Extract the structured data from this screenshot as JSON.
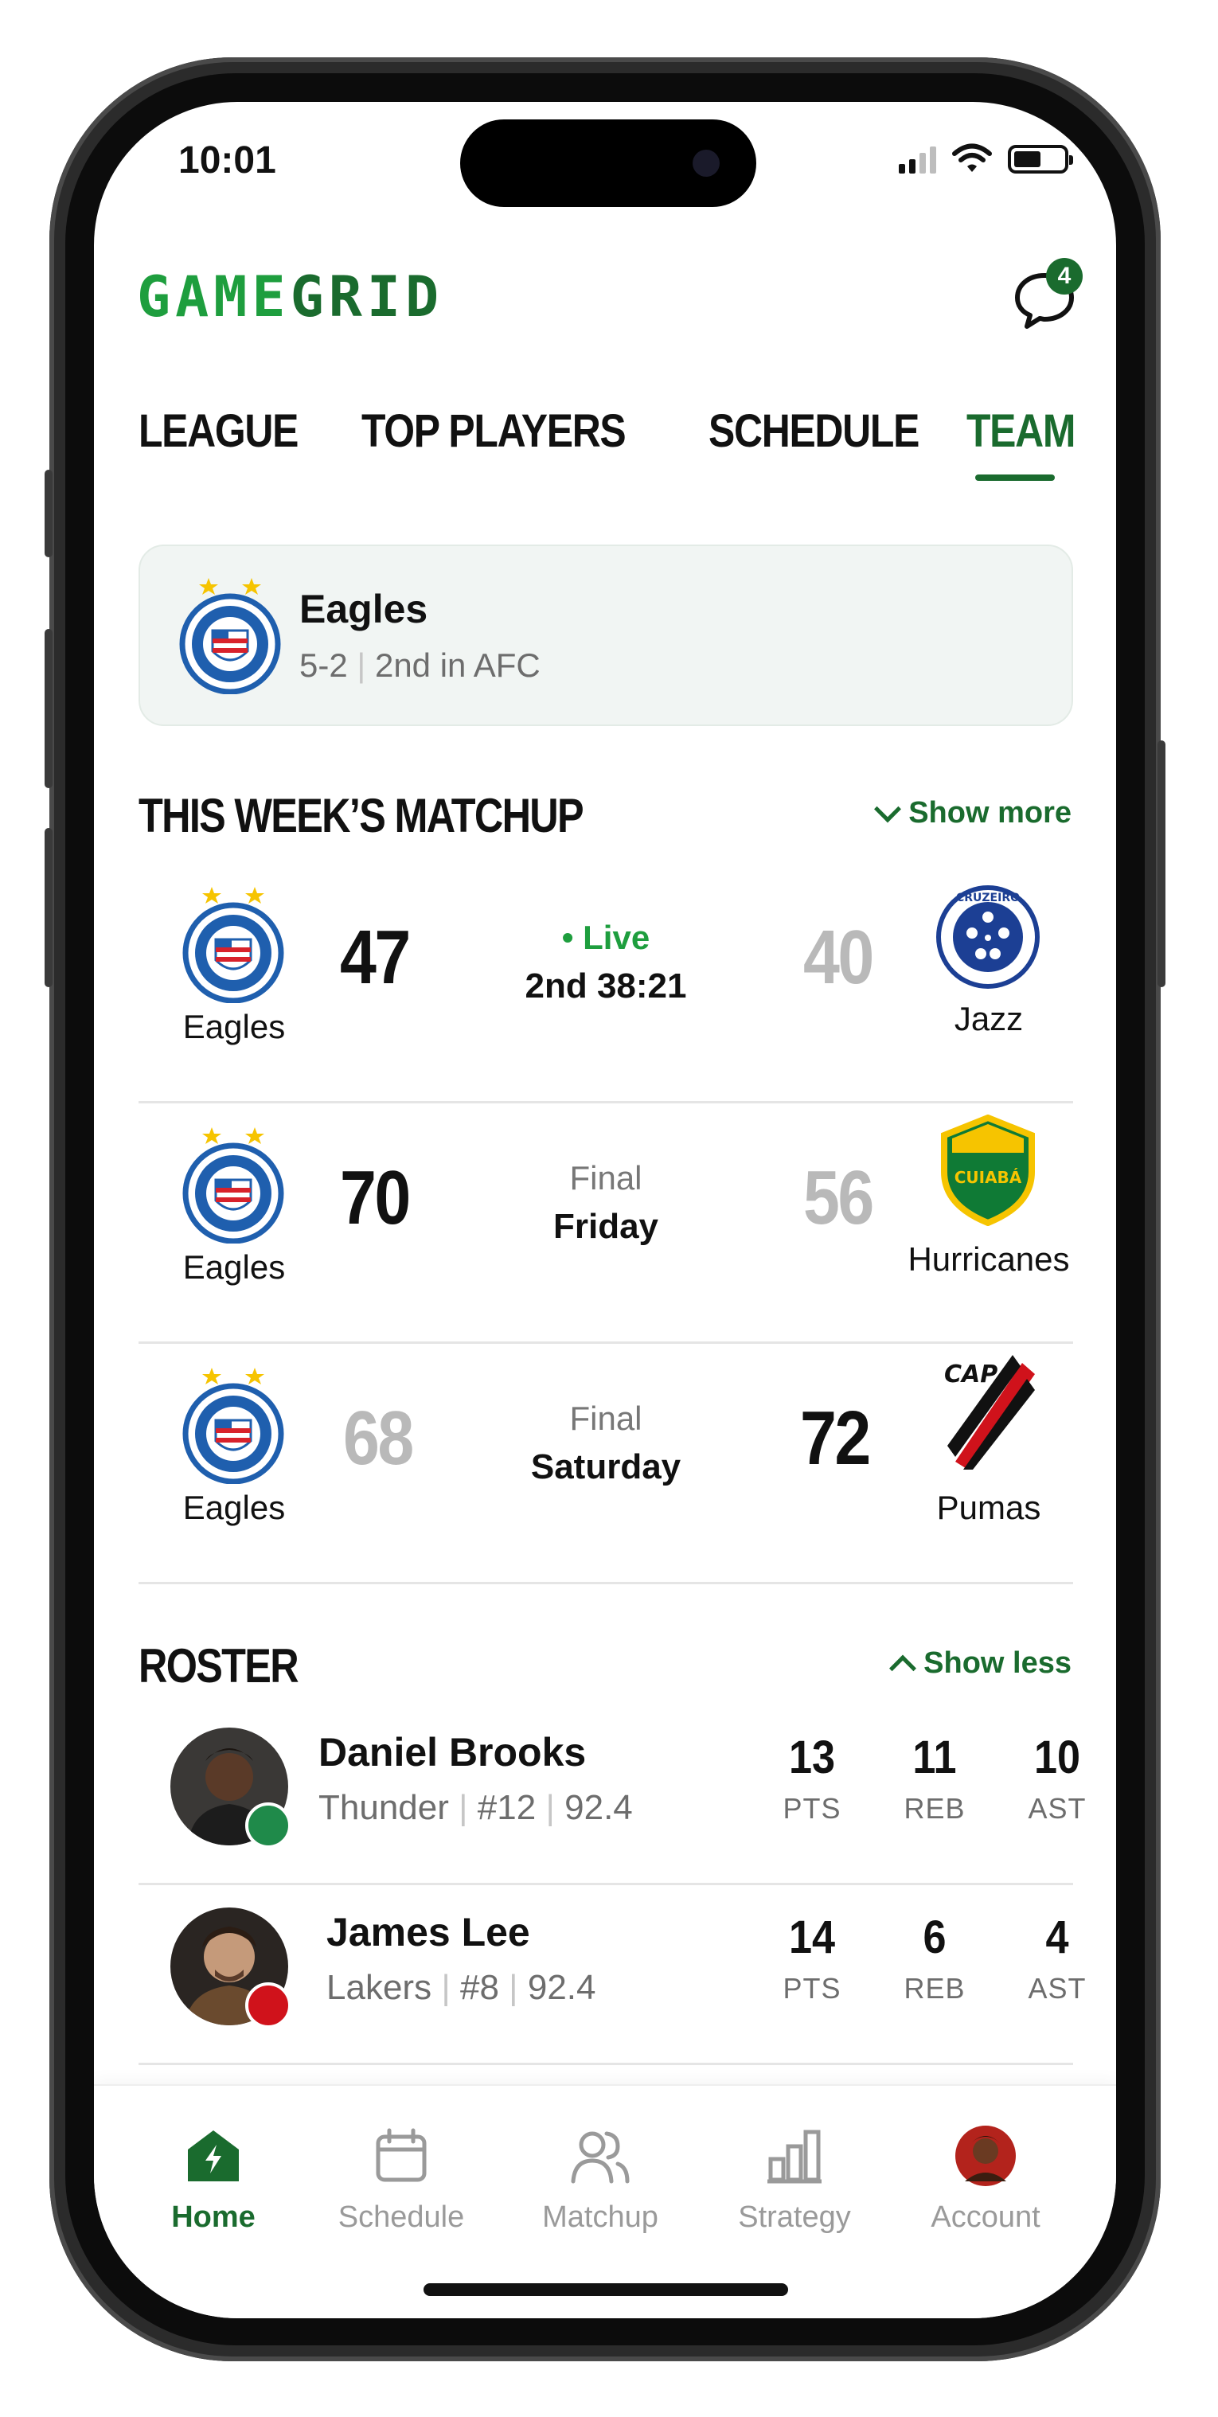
{
  "status_bar": {
    "time": "10:01"
  },
  "header": {
    "logo_part1": "GAME",
    "logo_part2": "GRID",
    "chat_badge": "4"
  },
  "tabs": [
    "LEAGUE",
    "TOP PLAYERS",
    "SCHEDULE",
    "TEAM"
  ],
  "active_tab": "TEAM",
  "team_card": {
    "name": "Eagles",
    "record": "5-2",
    "standing": "2nd in AFC"
  },
  "matchup_section": {
    "title": "THIS WEEK’S MATCHUP",
    "toggle_label": "Show more"
  },
  "matchups": [
    {
      "home": "Eagles",
      "home_score": "47",
      "status": "• Live",
      "detail": "2nd 38:21",
      "away": "Jazz",
      "away_score": "40"
    },
    {
      "home": "Eagles",
      "home_score": "70",
      "status": "Final",
      "detail": "Friday",
      "away": "Hurricanes",
      "away_score": "56"
    },
    {
      "home": "Eagles",
      "home_score": "68",
      "status": "Final",
      "detail": "Saturday",
      "away": "Pumas",
      "away_score": "72"
    }
  ],
  "away_logo_text": {
    "cruzeiro": "CRUZEIRO",
    "cuiaba": "CUIABÁ",
    "cap": "CAP"
  },
  "roster_section": {
    "title": "ROSTER",
    "toggle_label": "Show less"
  },
  "roster": [
    {
      "name": "Daniel Brooks",
      "team": "Thunder",
      "number": "#12",
      "rating": "92.4",
      "pts": "13",
      "reb": "11",
      "ast": "10"
    },
    {
      "name": "James Lee",
      "team": "Lakers",
      "number": "#8",
      "rating": "92.4",
      "pts": "14",
      "reb": "6",
      "ast": "4"
    }
  ],
  "stat_labels": {
    "pts": "PTS",
    "reb": "REB",
    "ast": "AST"
  },
  "bottom_nav": [
    "Home",
    "Schedule",
    "Matchup",
    "Strategy",
    "Account"
  ],
  "colors": {
    "brand_dark": "#1a6b2e",
    "brand_light": "#1e9e3e",
    "muted": "#b9b9b9"
  }
}
